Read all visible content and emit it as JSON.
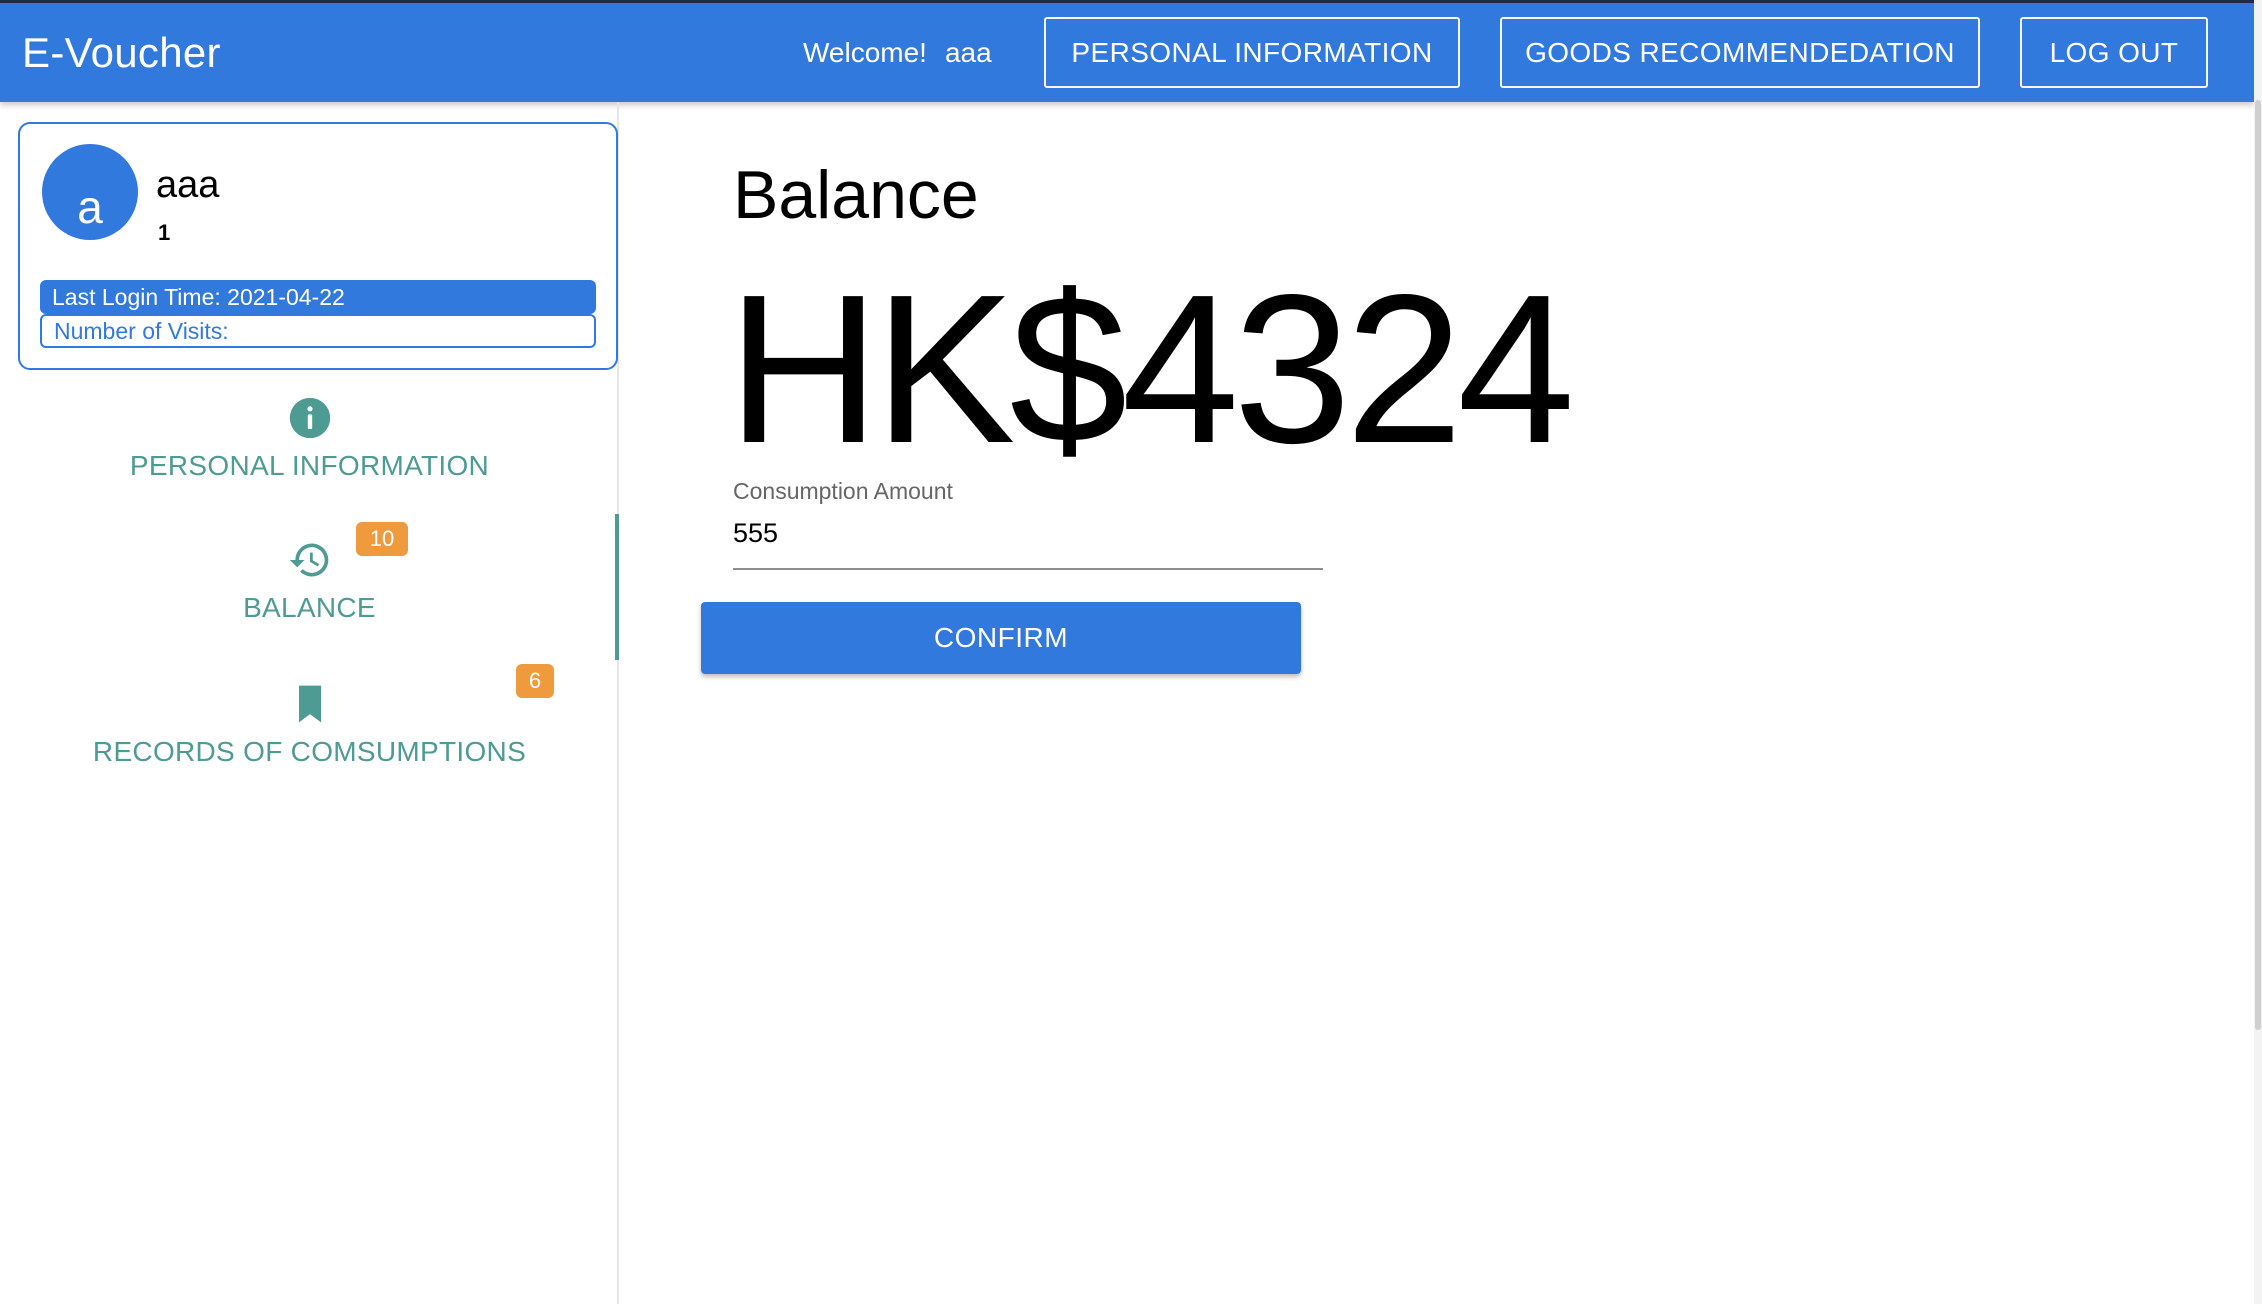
{
  "app": {
    "title": "E-Voucher"
  },
  "header": {
    "welcome_prefix": "Welcome!",
    "welcome_user": "aaa",
    "nav": {
      "personal_info": "PERSONAL INFORMATION",
      "goods": "GOODS RECOMMENDEDATION",
      "logout": "LOG OUT"
    }
  },
  "profile": {
    "avatar_letter": "a",
    "name": "aaa",
    "id": "1",
    "last_login": "Last Login Time: 2021-04-22",
    "visits": "Number of Visits:"
  },
  "sidebar": {
    "items": [
      {
        "label": "PERSONAL INFORMATION",
        "icon": "info-icon",
        "badge": null
      },
      {
        "label": "BALANCE",
        "icon": "history-icon",
        "badge": "10",
        "active": true
      },
      {
        "label": "RECORDS OF COMSUMPTIONS",
        "icon": "bookmark-icon",
        "badge": "6"
      }
    ]
  },
  "main": {
    "title": "Balance",
    "amount": "HK$4324",
    "consumption_label": "Consumption Amount",
    "consumption_value": "555",
    "confirm_label": "CONFIRM"
  },
  "colors": {
    "primary": "#3279de",
    "teal": "#4d9b93",
    "badge": "#f09a3e"
  }
}
